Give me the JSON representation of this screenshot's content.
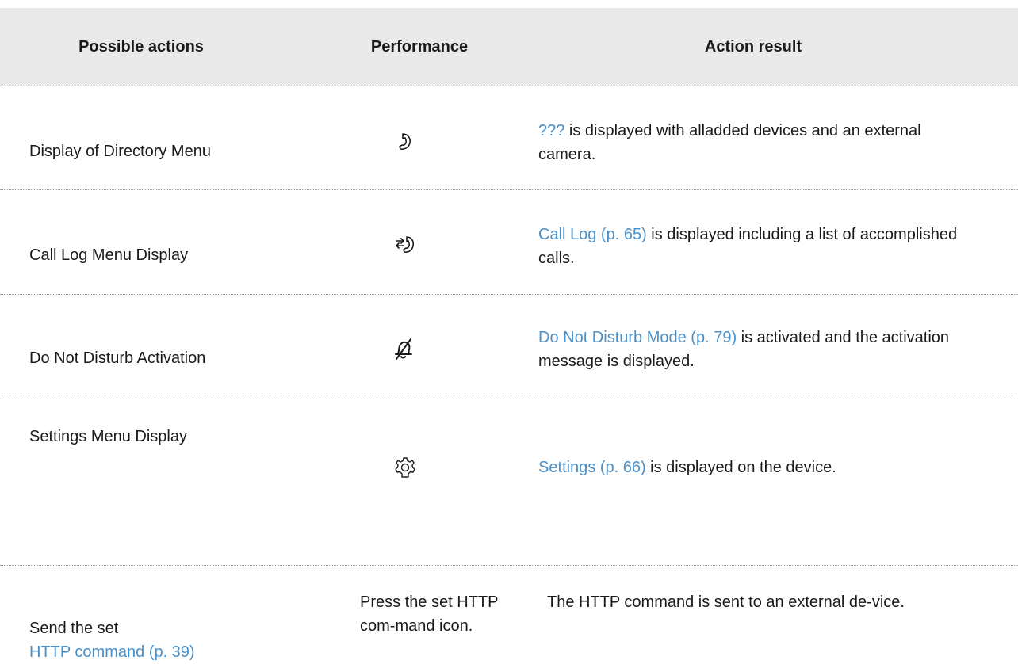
{
  "table": {
    "headers": [
      "Possible actions",
      "Performance",
      "Action result"
    ],
    "rows": [
      {
        "action": "Display of Directory Menu",
        "icon": "phone-handset-icon",
        "result_link": "???",
        "result_text": " is displayed with  alladded devices and an external camera."
      },
      {
        "action": "Call Log Menu Display",
        "icon": "call-log-icon",
        "result_link": "Call Log (p. 65)",
        "result_text": " is displayed including a list of accomplished calls."
      },
      {
        "action": "Do Not Disturb Activation",
        "icon": "bell-off-icon",
        "result_link": "Do Not Disturb Mode (p. 79)",
        "result_text": " is activated and the activation message is displayed."
      },
      {
        "action": "Settings Menu Display",
        "icon": "gear-icon",
        "result_link": "Settings (p. 66)",
        "result_text": " is displayed on the device."
      },
      {
        "action_text": "Send the set",
        "action_link": "HTTP command (p. 39)",
        "performance": "Press the set HTTP com-mand icon.",
        "result_text": "The HTTP command is sent to an external de-vice."
      }
    ]
  },
  "colors": {
    "header_bg": "#e9e9e9",
    "link": "#4a90c8",
    "text": "#1a1a1a"
  }
}
